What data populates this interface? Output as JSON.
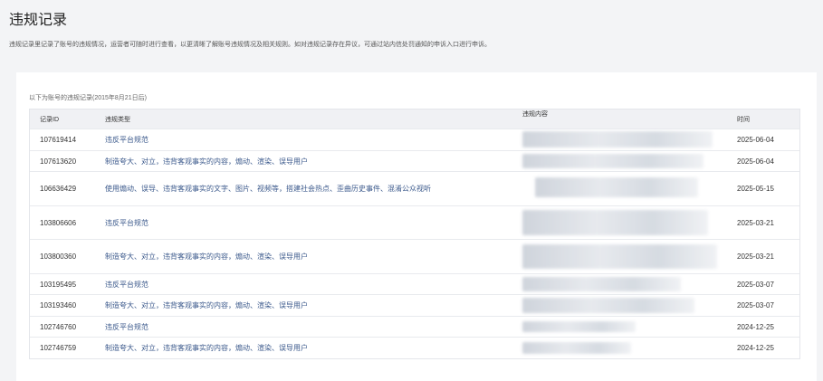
{
  "page": {
    "title": "违规记录",
    "description": "违规记录里记录了账号的违规情况，运营者可随时进行查看，以更清晰了解账号违规情况及相关规则。如对违规记录存在异议，可通过站内信处罚通知的申诉入口进行申诉。"
  },
  "table": {
    "subheading": "以下为账号的违规记录(2015年8月21日后)",
    "columns": {
      "id": "记录ID",
      "type": "违规类型",
      "content": "违规内容",
      "time": "时间"
    },
    "rows": [
      {
        "id": "107619414",
        "type": "违反平台规范",
        "time": "2025-06-04"
      },
      {
        "id": "107613620",
        "type": "制造夸大、对立，违背客观事实的内容，煽动、渲染、误导用户",
        "time": "2025-06-04"
      },
      {
        "id": "106636429",
        "type": "使用煽动、误导、违背客观事实的文字、图片、视频等，搭建社会热点、歪曲历史事件、混淆公众视听",
        "time": "2025-05-15"
      },
      {
        "id": "103806606",
        "type": "违反平台规范",
        "time": "2025-03-21"
      },
      {
        "id": "103800360",
        "type": "制造夸大、对立，违背客观事实的内容，煽动、渲染、误导用户",
        "time": "2025-03-21"
      },
      {
        "id": "103195495",
        "type": "违反平台规范",
        "time": "2025-03-07"
      },
      {
        "id": "103193460",
        "type": "制造夸大、对立，违背客观事实的内容，煽动、渲染、误导用户",
        "time": "2025-03-07"
      },
      {
        "id": "102746760",
        "type": "违反平台规范",
        "time": "2024-12-25"
      },
      {
        "id": "102746759",
        "type": "制造夸大、对立，违背客观事实的内容，煽动、渲染、误导用户",
        "time": "2024-12-25"
      }
    ]
  }
}
